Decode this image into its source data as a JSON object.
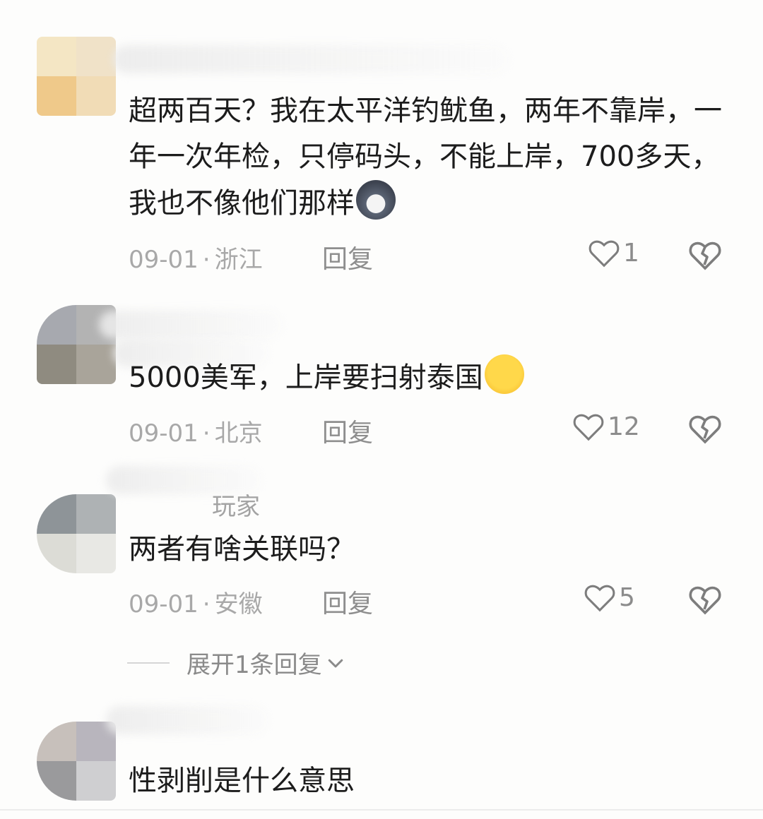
{
  "comments": [
    {
      "username": "",
      "text": "超两百天？我在太平洋钓鱿鱼，两年不靠岸，一年一次年检，只停码头，不能上岸，700多天，我也不像他们那样",
      "emoji": "wolf-face-emoji",
      "date": "09-01",
      "location": "浙江",
      "reply_label": "回复",
      "like_count": "1"
    },
    {
      "username": "",
      "text": "5000美军，上岸要扫射泰国",
      "emoji": "crying-face-emoji",
      "date": "09-01",
      "location": "北京",
      "reply_label": "回复",
      "like_count": "12"
    },
    {
      "username": "玩家",
      "text": "两者有啥关联吗？",
      "emoji": "",
      "date": "09-01",
      "location": "安徽",
      "reply_label": "回复",
      "like_count": "5"
    },
    {
      "username": "",
      "text": "性剥削是什么意思",
      "emoji": "",
      "date": "",
      "location": "",
      "reply_label": "",
      "like_count": ""
    }
  ],
  "expand_replies_label": "展开1条回复",
  "separator_dot": "·",
  "icons": {
    "like": "heart-outline-icon",
    "dislike": "broken-heart-icon",
    "expand": "chevron-down-icon"
  },
  "colors": {
    "background": "#fdfdfc",
    "text": "#1c1c1c",
    "meta": "#a8a8a8"
  }
}
